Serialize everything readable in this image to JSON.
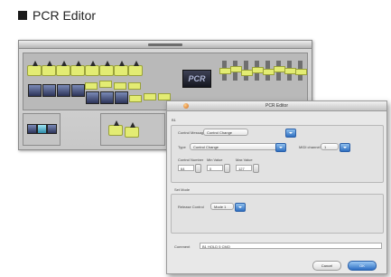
{
  "heading": {
    "title": "PCR Editor"
  },
  "pcr_editor": {
    "lcd_text": "PCR"
  },
  "dialog": {
    "title": "PCR Editor",
    "section_label": "B1",
    "control_message_label": "Control Message",
    "control_message_value": "Control Change",
    "type_label": "Type",
    "type_value": "Control Change",
    "midi_channel_label": "MIDI channel",
    "midi_channel_value": "1",
    "control_number_label": "Control Number",
    "control_number_value": "64",
    "min_value_label": "Min Value",
    "min_value_value": "0",
    "max_value_label": "Max Value",
    "max_value_value": "127",
    "sub_section_label": "Set Mode",
    "mode_label": "Release Control",
    "mode_value": "Mode 1",
    "comment_label": "Comment",
    "comment_value": "B1 HOLD 5 CMO",
    "cancel_label": "Cancel",
    "ok_label": "OK"
  }
}
